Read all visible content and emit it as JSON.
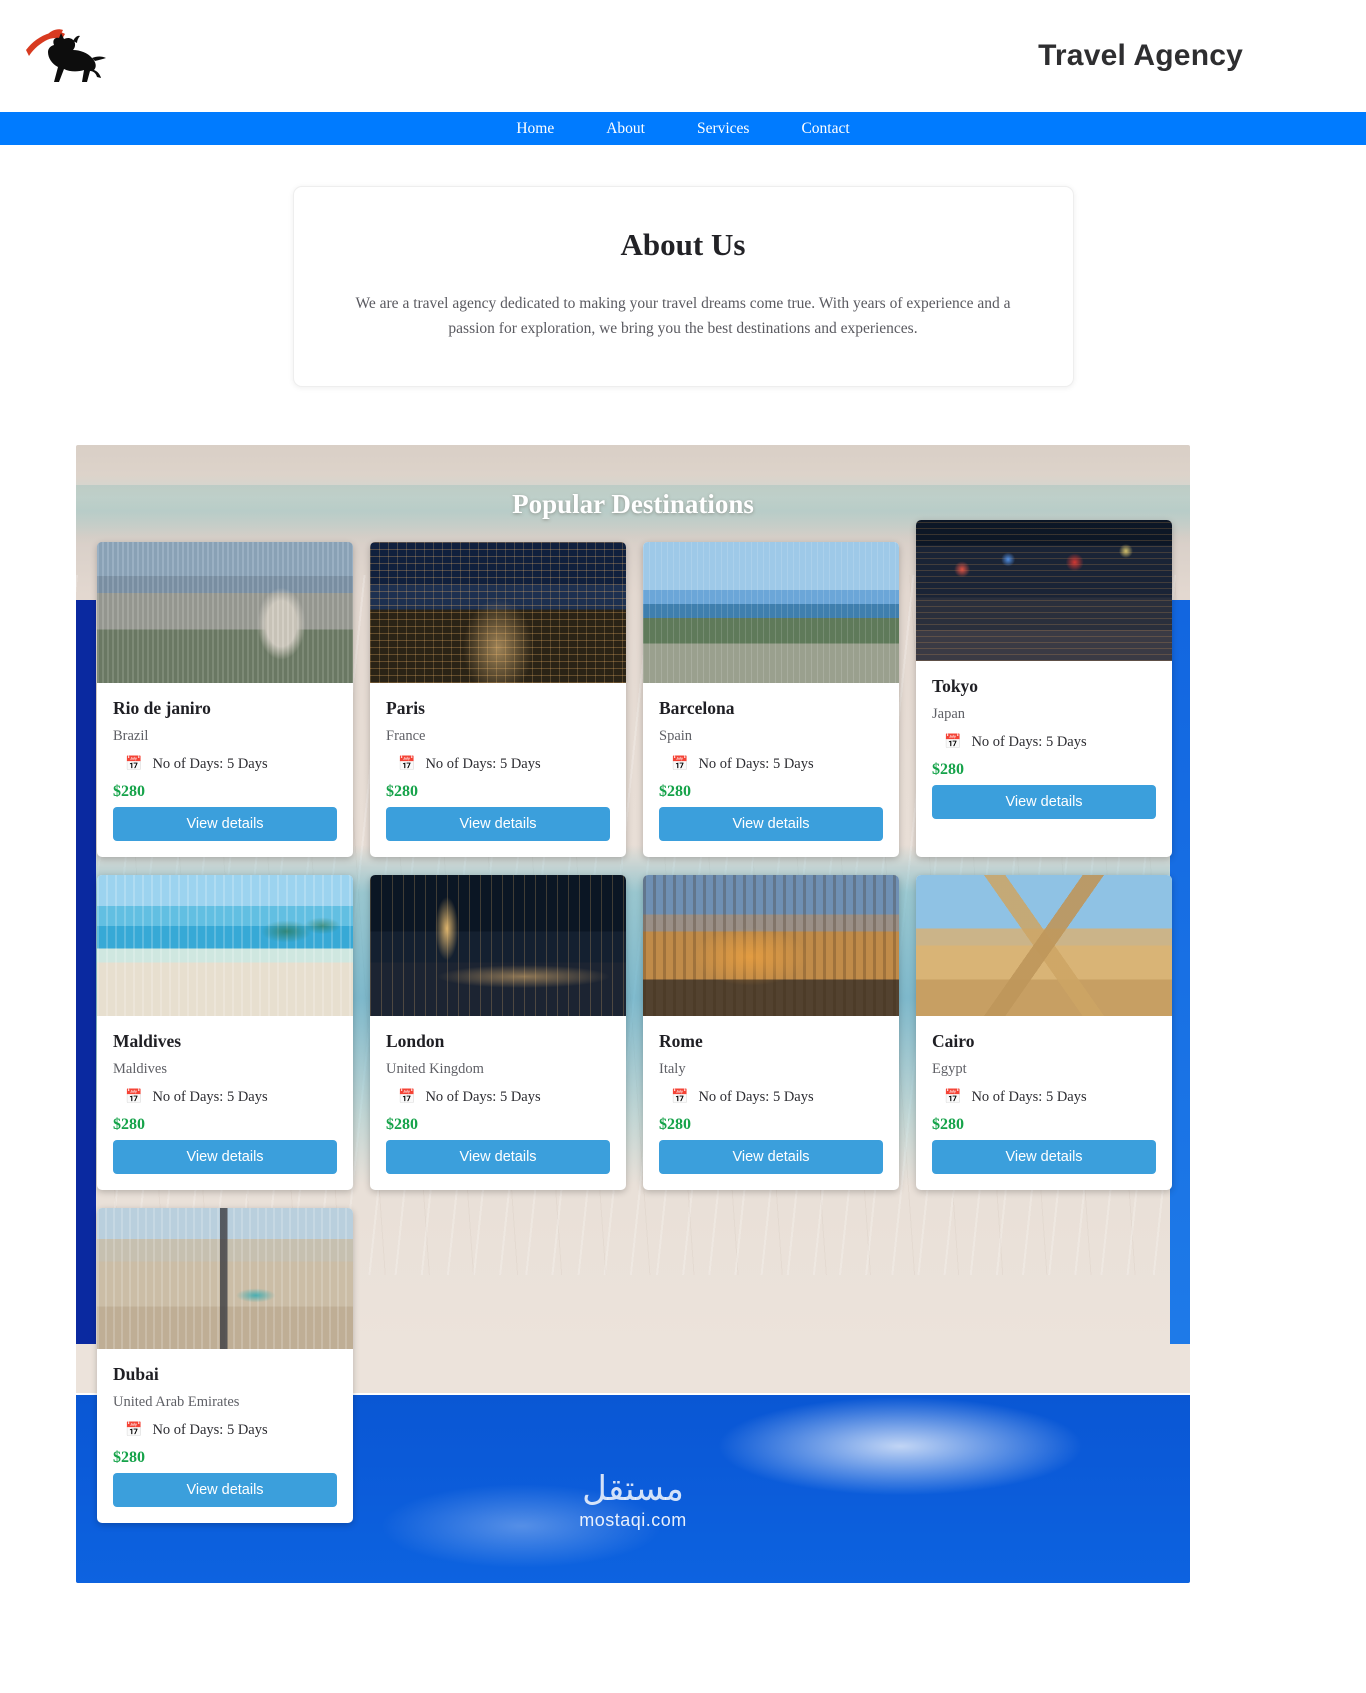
{
  "header": {
    "brand_title": "Travel Agency",
    "logo_icon": "bull-with-red-cape-logo",
    "logo_colors": {
      "bull": "#0d0d0d",
      "cape": "#d83a20"
    }
  },
  "nav": {
    "background_color": "#007bff",
    "items": [
      {
        "label": "Home"
      },
      {
        "label": "About"
      },
      {
        "label": "Services"
      },
      {
        "label": "Contact"
      }
    ]
  },
  "about": {
    "title": "About Us",
    "text": "We are a travel agency dedicated to making your travel dreams come true. With years of experience and a passion for exploration, we bring you the best destinations and experiences."
  },
  "destinations": {
    "title": "Popular Destinations",
    "calendar_icon": "calendar-icon",
    "price_color": "#16a34a",
    "button_color": "#3b9fdc",
    "cards": [
      {
        "city": "Rio de janiro",
        "country": "Brazil",
        "days": "No of Days: 5 Days",
        "price": "$280",
        "button": "View details",
        "photo": "rio-de-janeiro-photo"
      },
      {
        "city": "Paris",
        "country": "France",
        "days": "No of Days: 5 Days",
        "price": "$280",
        "button": "View details",
        "photo": "paris-night-photo"
      },
      {
        "city": "Barcelona",
        "country": "Spain",
        "days": "No of Days: 5 Days",
        "price": "$280",
        "button": "View details",
        "photo": "barcelona-harbor-photo"
      },
      {
        "city": "Tokyo",
        "country": "Japan",
        "days": "No of Days: 5 Days",
        "price": "$280",
        "button": "View details",
        "photo": "tokyo-neon-street-photo"
      },
      {
        "city": "Maldives",
        "country": "Maldives",
        "days": "No of Days: 5 Days",
        "price": "$280",
        "button": "View details",
        "photo": "maldives-beach-photo"
      },
      {
        "city": "London",
        "country": "United Kingdom",
        "days": "No of Days: 5 Days",
        "price": "$280",
        "button": "View details",
        "photo": "london-big-ben-photo"
      },
      {
        "city": "Rome",
        "country": "Italy",
        "days": "No of Days: 5 Days",
        "price": "$280",
        "button": "View details",
        "photo": "rome-colosseum-photo"
      },
      {
        "city": "Cairo",
        "country": "Egypt",
        "days": "No of Days: 5 Days",
        "price": "$280",
        "button": "View details",
        "photo": "cairo-pyramids-photo"
      },
      {
        "city": "Dubai",
        "country": "United Arab Emirates",
        "days": "No of Days: 5 Days",
        "price": "$280",
        "button": "View details",
        "photo": "dubai-skyline-photo"
      }
    ]
  },
  "watermark": {
    "arabic": "مستقل",
    "latin": "mostaqi.com"
  }
}
